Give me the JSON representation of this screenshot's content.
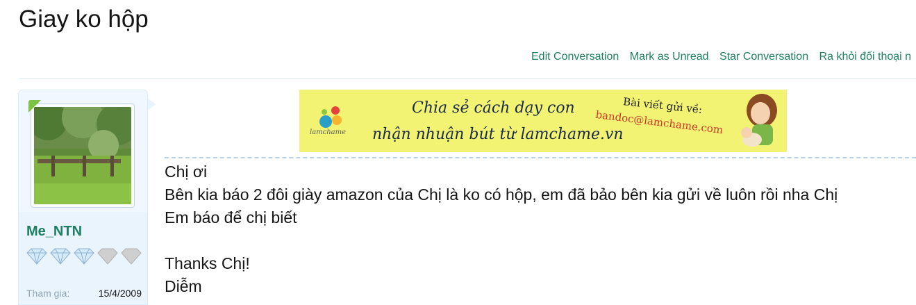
{
  "page": {
    "title": "Giay ko hộp"
  },
  "actions": [
    {
      "label": "Edit Conversation"
    },
    {
      "label": "Mark as Unread"
    },
    {
      "label": "Star Conversation"
    },
    {
      "label": "Ra khỏi đối thoại n"
    }
  ],
  "sidebar": {
    "username": "Me_NTN",
    "rank_diamonds_filled": 3,
    "rank_diamonds_total": 5,
    "join_label": "Tham gia:",
    "join_value": "15/4/2009"
  },
  "banner": {
    "line1": "Chia sẻ cách dạy con",
    "line2": "nhận nhuận bút từ lamchame.vn",
    "note": "Bài viết gửi về:",
    "email": "bandoc@lamchame.com",
    "logo_text": "lamchame"
  },
  "message": {
    "lines": [
      "Chị ơi",
      "Bên kia báo 2 đôi giày amazon của Chị là ko có hộp, em đã bảo bên kia gửi về luôn rồi nha Chị",
      "Em báo để chị biết",
      "",
      "Thanks Chị!",
      "Diễm"
    ]
  },
  "colors": {
    "link": "#1d7f5f",
    "sidebar_bg": "#e9f4fd",
    "banner_bg": "#f2f372",
    "accent_green": "#7cc243"
  }
}
